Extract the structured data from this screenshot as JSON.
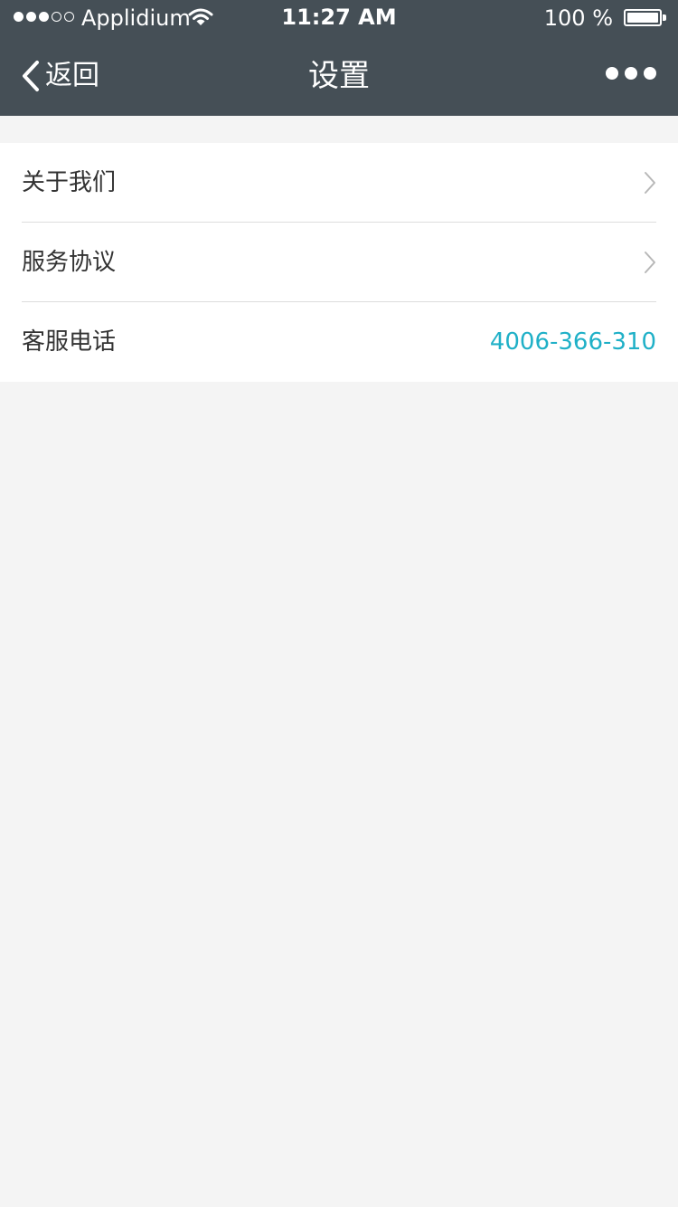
{
  "status_bar": {
    "carrier": "Applidium",
    "time": "11:27 AM",
    "battery": "100 %",
    "signal_level": "3 of 5"
  },
  "nav": {
    "back_label": "返回",
    "title": "设置"
  },
  "settings": {
    "items": [
      {
        "label": "关于我们"
      },
      {
        "label": "服务协议"
      },
      {
        "label": "客服电话",
        "value": "4006-366-310"
      }
    ]
  },
  "colors": {
    "header_bg": "#454f56",
    "page_bg": "#f4f4f4",
    "accent": "#1fb0c7"
  },
  "icons": [
    "back-chevron-icon",
    "more-icon",
    "chevron-right-icon",
    "wifi-icon",
    "battery-icon",
    "signal-icon"
  ]
}
